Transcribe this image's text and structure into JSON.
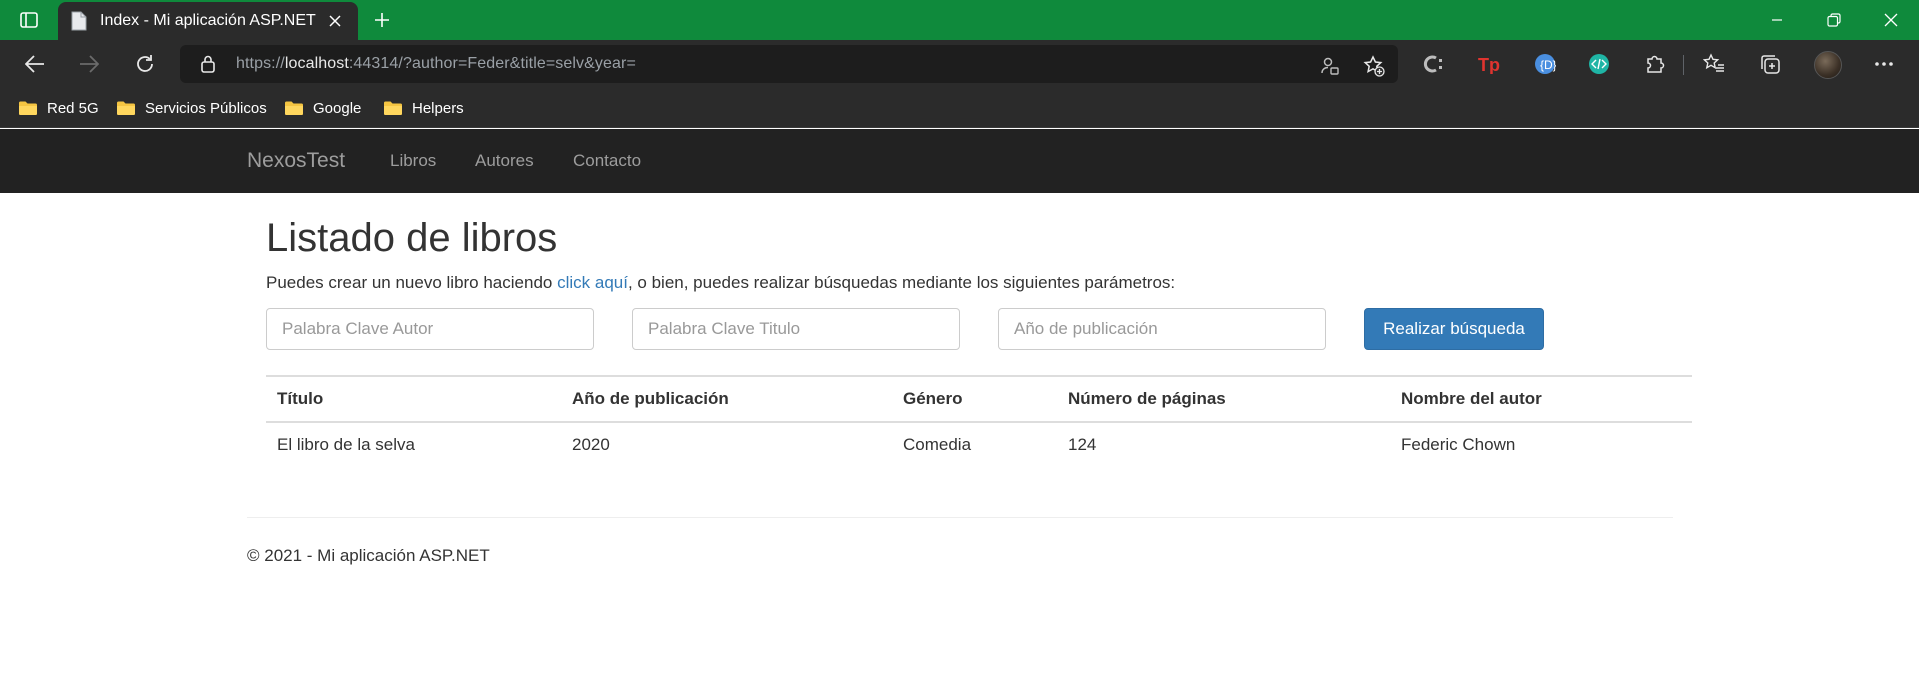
{
  "browser": {
    "tab_title": "Index - Mi aplicación ASP.NET",
    "url_scheme": "https://",
    "url_host": "localhost",
    "url_rest": ":44314/?author=Feder&title=selv&year=",
    "accent_color": "#0f8a3c",
    "toolbar_icons": [
      "person-key-icon",
      "favorite-add-icon",
      "extension-c-icon",
      "extension-tp-icon",
      "extension-d-icon",
      "extension-code-icon",
      "extensions-puzzle-icon",
      "favorites-icon",
      "collections-icon",
      "profile-avatar",
      "more-icon"
    ],
    "bookmarks": [
      {
        "label": "Red 5G"
      },
      {
        "label": "Servicios Públicos"
      },
      {
        "label": "Google"
      },
      {
        "label": "Helpers"
      }
    ]
  },
  "site": {
    "brand": "NexosTest",
    "nav": [
      {
        "label": "Libros"
      },
      {
        "label": "Autores"
      },
      {
        "label": "Contacto"
      }
    ]
  },
  "main": {
    "title": "Listado de libros",
    "intro_before": "Puedes crear un nuevo libro haciendo ",
    "intro_link": "click aquí",
    "intro_after": ", o bien, puedes realizar búsquedas mediante los siguientes parámetros:",
    "search": {
      "author_placeholder": "Palabra Clave Autor",
      "title_placeholder": "Palabra Clave Titulo",
      "year_placeholder": "Año de publicación",
      "button_label": "Realizar búsqueda"
    },
    "table": {
      "headers": [
        "Título",
        "Año de publicación",
        "Género",
        "Número de páginas",
        "Nombre del autor"
      ],
      "rows": [
        [
          "El libro de la selva",
          "2020",
          "Comedia",
          "124",
          "Federic Chown"
        ]
      ]
    }
  },
  "footer": {
    "text": "© 2021 - Mi aplicación ASP.NET"
  }
}
